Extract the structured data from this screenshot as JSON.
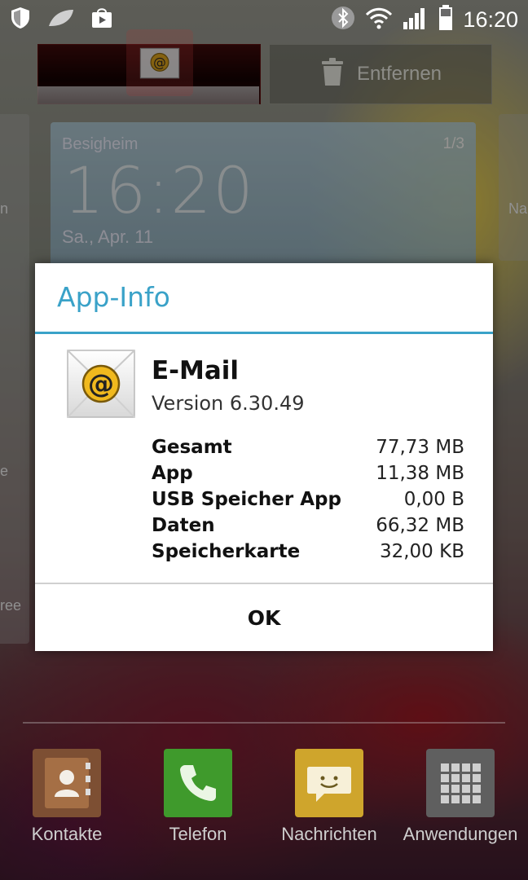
{
  "status_bar": {
    "time": "16:20"
  },
  "drop_targets": {
    "remove_label": "Entfernen"
  },
  "widget": {
    "location": "Besigheim",
    "page": "1/3",
    "time": "16:20",
    "date": "Sa., Apr. 11"
  },
  "side_labels": {
    "left_1": "n",
    "left_2": "e",
    "left_3": "ree",
    "right_1": "Na"
  },
  "dialog": {
    "title": "App-Info",
    "app_name": "E-Mail",
    "version": "Version 6.30.49",
    "stats": [
      {
        "label": "Gesamt",
        "value": "77,73 MB"
      },
      {
        "label": "App",
        "value": "11,38 MB"
      },
      {
        "label": "USB Speicher App",
        "value": "0,00 B"
      },
      {
        "label": "Daten",
        "value": "66,32 MB"
      },
      {
        "label": "Speicherkarte",
        "value": "32,00 KB"
      }
    ],
    "ok_label": "OK"
  },
  "dock": [
    {
      "label": "Kontakte",
      "icon": "contacts-icon",
      "color": "#8a5a3a"
    },
    {
      "label": "Telefon",
      "icon": "phone-icon",
      "color": "#3f9a2c"
    },
    {
      "label": "Nachrichten",
      "icon": "messages-icon",
      "color": "#d8b23a"
    },
    {
      "label": "Anwendungen",
      "icon": "apps-grid-icon",
      "color": "#6f6f6f"
    }
  ],
  "accent_color": "#3aa2c8"
}
